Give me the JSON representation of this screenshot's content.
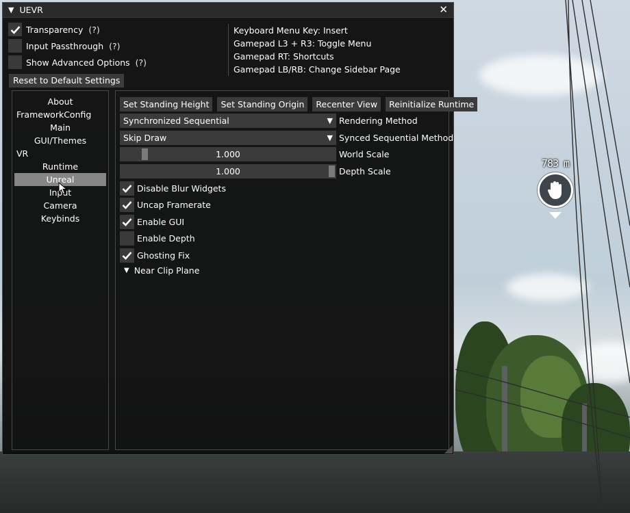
{
  "window": {
    "title": "UEVR",
    "options": [
      {
        "label": "Transparency",
        "help": "(?)",
        "checked": true
      },
      {
        "label": "Input Passthrough",
        "help": "(?)",
        "checked": false
      },
      {
        "label": "Show Advanced Options",
        "help": "(?)",
        "checked": false
      }
    ],
    "reset_label": "Reset to Default Settings",
    "keyhelp": [
      "Keyboard Menu Key: Insert",
      "Gamepad L3 + R3: Toggle Menu",
      "Gamepad RT: Shortcuts",
      "Gamepad LB/RB: Change Sidebar Page"
    ]
  },
  "sidebar": {
    "items": [
      {
        "label": "About"
      },
      {
        "label": "FrameworkConfig"
      },
      {
        "label": "Main"
      },
      {
        "label": "GUI/Themes"
      },
      {
        "label": "VR"
      },
      {
        "label": "Runtime"
      },
      {
        "label": "Unreal",
        "selected": true
      },
      {
        "label": "Input"
      },
      {
        "label": "Camera"
      },
      {
        "label": "Keybinds"
      }
    ]
  },
  "content": {
    "buttons": [
      {
        "label": "Set Standing Height"
      },
      {
        "label": "Set Standing Origin"
      },
      {
        "label": "Recenter View"
      },
      {
        "label": "Reinitialize Runtime"
      }
    ],
    "rendering_method": {
      "value": "Synchronized Sequential",
      "label": "Rendering Method"
    },
    "synced_method": {
      "value": "Skip Draw",
      "label": "Synced Sequential Method"
    },
    "world_scale": {
      "value": "1.000",
      "label": "World Scale",
      "fraction": 0.1
    },
    "depth_scale": {
      "value": "1.000",
      "label": "Depth Scale",
      "fraction": 1.0
    },
    "checkboxes": [
      {
        "label": "Disable Blur Widgets",
        "checked": true
      },
      {
        "label": "Uncap Framerate",
        "checked": true
      },
      {
        "label": "Enable GUI",
        "checked": true
      },
      {
        "label": "Enable Depth",
        "checked": false
      },
      {
        "label": "Ghosting Fix",
        "checked": true
      }
    ],
    "near_clip_label": "Near Clip Plane"
  },
  "game": {
    "marker_distance": "783 m",
    "marker_icon": "hand-icon"
  },
  "colors": {
    "window_bg": "#0e0e0e",
    "frame_bg": "#3b3b3b",
    "selected_bg": "#868686",
    "text": "#ffffff"
  }
}
